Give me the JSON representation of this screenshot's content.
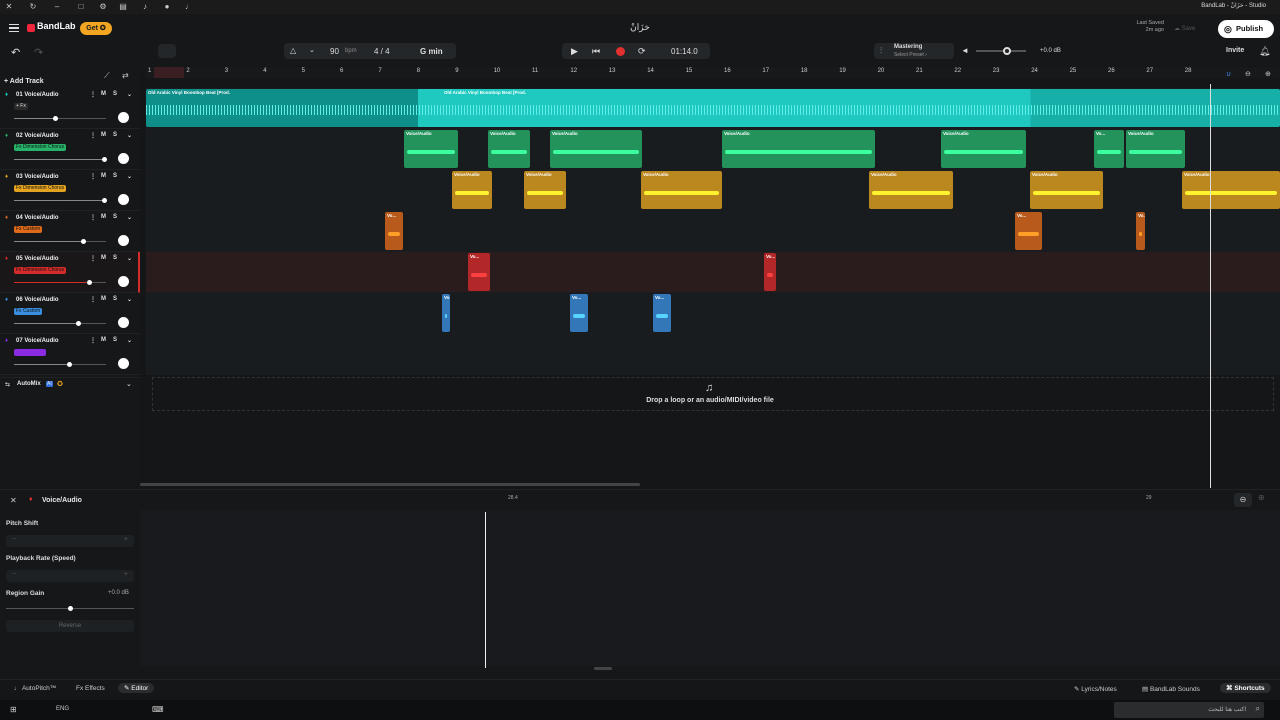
{
  "window_title": "BandLab - خزَانْ - Studio",
  "app": {
    "brand": "BandLab",
    "get_label": "Get",
    "project_title": "خزَانْ",
    "last_saved_label": "Last Saved",
    "last_saved_time": "2m ago",
    "save_label": "Save",
    "publish_label": "Publish",
    "invite_label": "Invite"
  },
  "transport": {
    "bpm": "90",
    "bpm_unit": "bpm",
    "time_signature": "4 / 4",
    "key": "G min",
    "time": "01:14.0",
    "mastering_label": "Mastering",
    "mastering_preset": "Select Preset ›",
    "volume_db": "+0.0 dB"
  },
  "add_track_label": "Add Track",
  "tracks": [
    {
      "name": "01 Voice/Audio",
      "fx": "+ Fx",
      "fx_color": "#2b2b2b",
      "color": "#1fc9c0",
      "volume": 0.45
    },
    {
      "name": "02 Voice/Audio",
      "fx": "Fx Dimension Chorus",
      "fx_color": "#27b26a",
      "color": "#27b26a",
      "volume": 0.98
    },
    {
      "name": "03 Voice/Audio",
      "fx": "Fx Dimension Chorus",
      "fx_color": "#e3a21f",
      "color": "#e3a21f",
      "volume": 0.98
    },
    {
      "name": "04 Voice/Audio",
      "fx": "Fx Custom",
      "fx_color": "#e06a1a",
      "color": "#e06a1a",
      "volume": 0.75
    },
    {
      "name": "05 Voice/Audio",
      "fx": "Fx Dimension Chorus",
      "fx_color": "#d42b2b",
      "color": "#d42b2b",
      "volume": 0.82
    },
    {
      "name": "06 Voice/Audio",
      "fx": "Fx Custom",
      "fx_color": "#3a8ee0",
      "color": "#3a8ee0",
      "volume": 0.7
    },
    {
      "name": "07 Voice/Audio",
      "fx": "",
      "fx_color": "#8a2be2",
      "color": "#8a2be2",
      "volume": 0.6
    }
  ],
  "automix_label": "AutoMix",
  "automix_badge": "AI",
  "ruler_ticks": [
    "1",
    "2",
    "3",
    "4",
    "5",
    "6",
    "7",
    "8",
    "9",
    "10",
    "11",
    "12",
    "13",
    "14",
    "15",
    "16",
    "17",
    "18",
    "19",
    "20",
    "21",
    "22",
    "23",
    "24",
    "25",
    "26",
    "27",
    "28"
  ],
  "clip_label_long": "Old Arabic Vinyl  Boombop Beat [Prod.",
  "clip_label": "Voice/Audio",
  "clip_label_short": "Vo...",
  "drop_text": "Drop a loop or an audio/MIDI/video file",
  "editor": {
    "title": "Voice/Audio",
    "ruler_a": "28.4",
    "ruler_b": "29",
    "pitch_shift": "Pitch Shift",
    "playback_rate": "Playback Rate (Speed)",
    "region_gain": "Region Gain",
    "region_gain_value": "+0.0 dB",
    "reverse": "Reverse"
  },
  "bottom_tabs": {
    "autopitch": "AutoPitch™",
    "effects": "Effects",
    "editor": "Editor",
    "lyrics": "Lyrics/Notes",
    "sounds": "BandLab Sounds",
    "shortcuts": "Shortcuts"
  },
  "taskbar": {
    "lang": "ENG",
    "search_placeholder": "اكتب هنا للبحث"
  }
}
